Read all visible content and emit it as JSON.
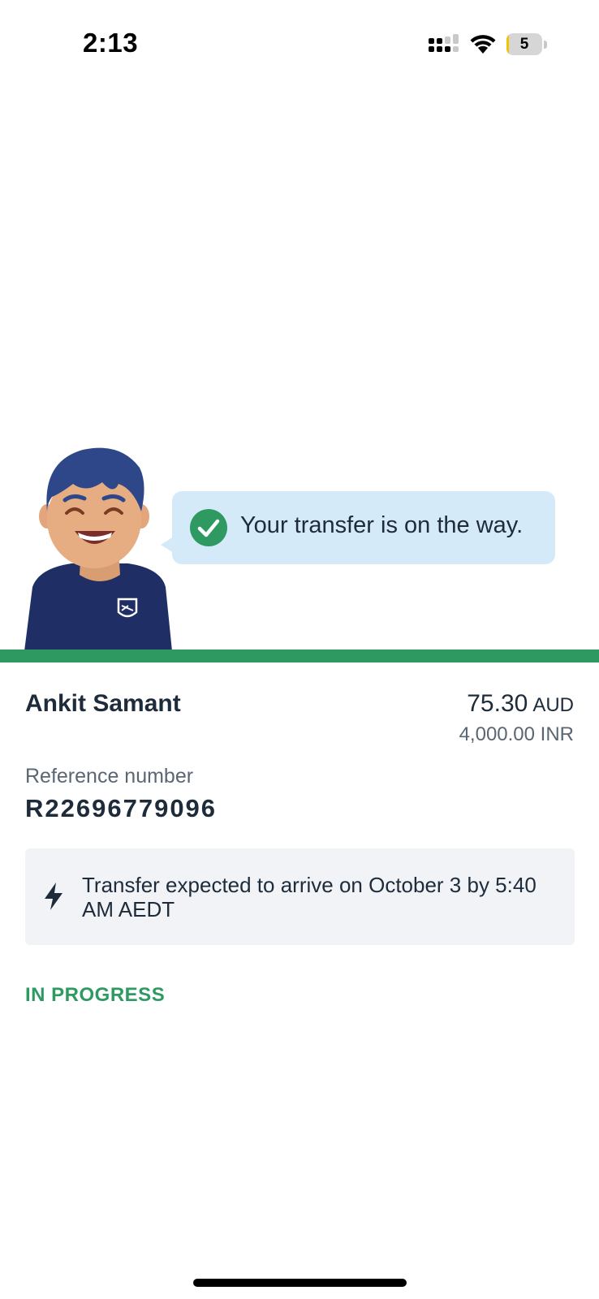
{
  "status_bar": {
    "time": "2:13",
    "battery_level": "5",
    "battery_fraction": 0.05,
    "signal_icon": "cellular-signal-icon",
    "wifi_icon": "wifi-icon"
  },
  "hero": {
    "avatar": "support-agent-avatar",
    "message": "Your transfer is on the way.",
    "message_icon": "check-circle-icon",
    "accent_color": "#2e9a61",
    "bubble_color": "#d5eaf8"
  },
  "transfer": {
    "recipient_name": "Ankit Samant",
    "send_amount": "75.30",
    "send_currency": "AUD",
    "receive_amount": "4,000.00 INR",
    "reference_label": "Reference number",
    "reference_number": "R22696779096",
    "eta_icon": "lightning-bolt-icon",
    "eta_text": "Transfer expected to arrive on October 3 by 5:40 AM AEDT",
    "status": "IN PROGRESS"
  }
}
